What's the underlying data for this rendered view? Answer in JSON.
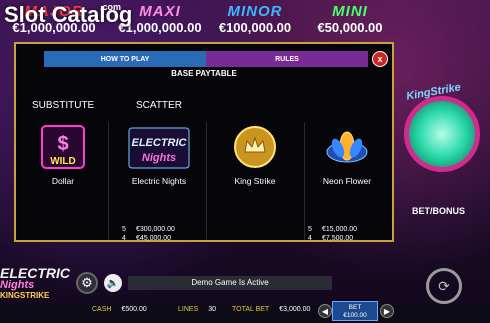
{
  "brand": {
    "title": "Slot Catalog",
    "sub": ".com"
  },
  "jackpots": [
    {
      "name": "MAJOR",
      "value": "€1,000,000.00"
    },
    {
      "name": "MAXI",
      "value": "€1,000,000.00"
    },
    {
      "name": "MINOR",
      "value": "€100,000.00"
    },
    {
      "name": "MINI",
      "value": "€50,000.00"
    }
  ],
  "modal": {
    "tabs": {
      "how_to_play": "HOW TO PLAY",
      "rules": "RULES"
    },
    "close_label": "x",
    "heading": "BASE PAYTABLE",
    "labels": {
      "substitute": "SUBSTITUTE",
      "scatter": "SCATTER"
    },
    "symbols": [
      {
        "name": "Dollar"
      },
      {
        "name": "Electric Nights",
        "pays": [
          {
            "count": "5",
            "amount": "€300,000.00"
          },
          {
            "count": "4",
            "amount": "€45,000.00"
          }
        ]
      },
      {
        "name": "King Strike"
      },
      {
        "name": "Neon Flower",
        "pays": [
          {
            "count": "5",
            "amount": "€15,000.00"
          },
          {
            "count": "4",
            "amount": "€7,500.00"
          }
        ]
      }
    ],
    "wild_text": "WILD"
  },
  "side": {
    "kingstrike": "KingStrike",
    "bet_bonus": "BET/BONUS"
  },
  "left_logo": {
    "line1": "ELECTRIC",
    "line2": "Nights",
    "line3": "KINGSTRIKE"
  },
  "demo_text": "Demo Game Is Active",
  "bottom": {
    "cash_label": "CASH",
    "cash_value": "€500.00",
    "lines_label": "LINES",
    "lines_value": "30",
    "total_bet_label": "TOTAL BET",
    "total_bet_value": "€3,000.00",
    "bet_label": "BET",
    "bet_value": "€100.00"
  },
  "colors": {
    "gold": "#c9a23a",
    "rules_tab": "#7a2a95",
    "play_tab": "#2a6bb8"
  }
}
